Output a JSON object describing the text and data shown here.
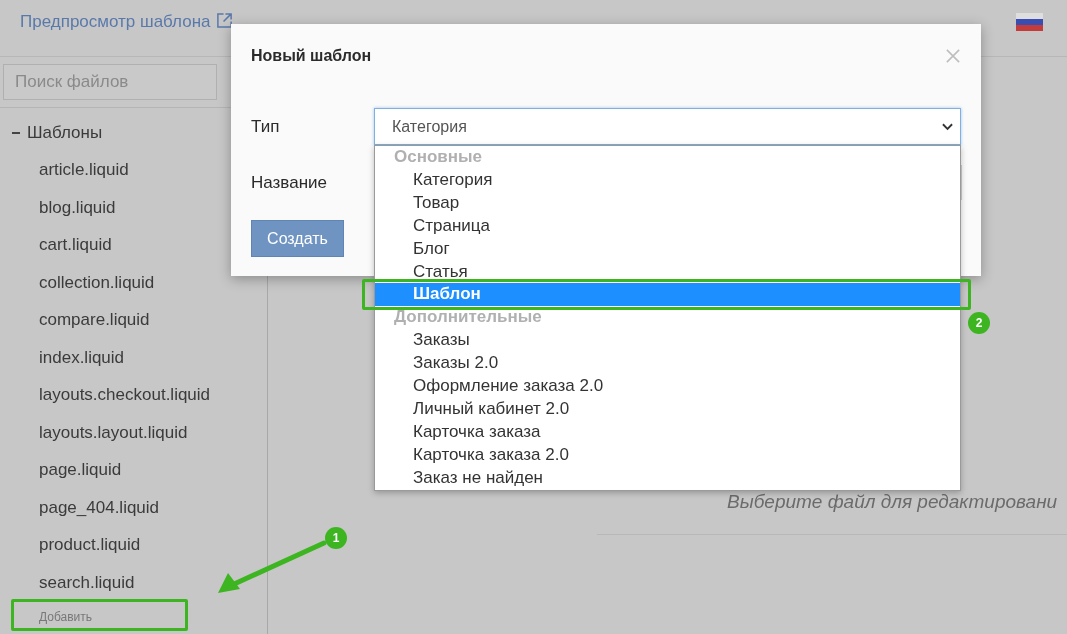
{
  "header": {
    "preview_link": "Предпросмотр шаблона"
  },
  "sidebar": {
    "search": {
      "placeholder": "Поиск файлов"
    },
    "tree": [
      {
        "label": "Шаблоны",
        "expanded": true,
        "children": [
          {
            "label": "article.liquid"
          },
          {
            "label": "blog.liquid"
          },
          {
            "label": "cart.liquid"
          },
          {
            "label": "collection.liquid"
          },
          {
            "label": "compare.liquid"
          },
          {
            "label": "index.liquid"
          },
          {
            "label": "layouts.checkout.liquid"
          },
          {
            "label": "layouts.layout.liquid"
          },
          {
            "label": "page.liquid"
          },
          {
            "label": "page_404.liquid"
          },
          {
            "label": "product.liquid"
          },
          {
            "label": "search.liquid"
          }
        ]
      }
    ],
    "add_button": "Добавить"
  },
  "main": {
    "empty_message": "Выберите файл для редактировани"
  },
  "modal": {
    "title": "Новый шаблон",
    "fields": [
      {
        "kind": "select",
        "label": "Тип",
        "value": "Категория",
        "open": true,
        "option_groups": [
          {
            "label": "Основные",
            "options": [
              {
                "label": "Категория",
                "selected": false
              },
              {
                "label": "Товар",
                "selected": false
              },
              {
                "label": "Страница",
                "selected": false
              },
              {
                "label": "Блог",
                "selected": false
              },
              {
                "label": "Статья",
                "selected": false
              },
              {
                "label": "Шаблон",
                "selected": true
              }
            ]
          },
          {
            "label": "Дополнительные",
            "options": [
              {
                "label": "Заказы",
                "selected": false
              },
              {
                "label": "Заказы 2.0",
                "selected": false
              },
              {
                "label": "Оформление заказа 2.0",
                "selected": false
              },
              {
                "label": "Личный кабинет 2.0",
                "selected": false
              },
              {
                "label": "Карточка заказа",
                "selected": false
              },
              {
                "label": "Карточка заказа 2.0",
                "selected": false
              },
              {
                "label": "Заказ не найден",
                "selected": false
              }
            ]
          }
        ]
      },
      {
        "kind": "text",
        "label": "Название"
      }
    ],
    "submit": "Создать"
  },
  "annotations": [
    {
      "label": "1",
      "arrow": true
    },
    {
      "label": "2",
      "arrow": false
    }
  ]
}
